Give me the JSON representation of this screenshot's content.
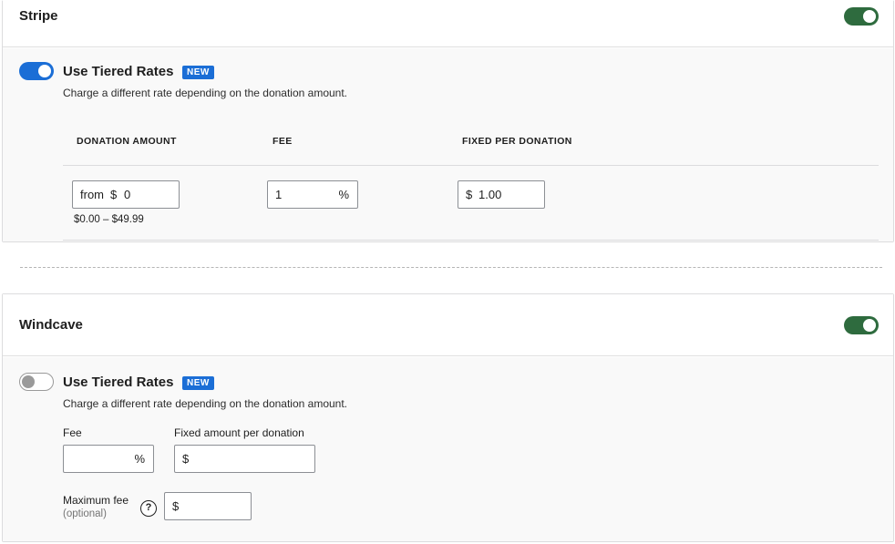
{
  "stripe": {
    "title": "Stripe",
    "tiered_label": "Use Tiered Rates",
    "badge": "NEW",
    "help": "Charge a different rate depending on the donation amount.",
    "columns": [
      "DONATION AMOUNT",
      "FEE",
      "FIXED PER DONATION"
    ],
    "row": {
      "from_prefix": "from",
      "from_currency": "$",
      "from_value": "0",
      "range_text": "$0.00 – $49.99",
      "fee_value": "1",
      "fee_suffix": "%",
      "fixed_currency": "$",
      "fixed_value": "1.00"
    }
  },
  "windcave": {
    "title": "Windcave",
    "tiered_label": "Use Tiered Rates",
    "badge": "NEW",
    "help": "Charge a different rate depending on the donation amount.",
    "fee_label": "Fee",
    "fee_suffix": "%",
    "fixed_label": "Fixed amount per donation",
    "fixed_currency": "$",
    "max_label": "Maximum fee",
    "max_sublabel": "(optional)",
    "help_icon_glyph": "?",
    "max_currency": "$"
  },
  "colors": {
    "enabled_toggle": "#2e6b3e",
    "accent_blue": "#1b6ed6"
  }
}
